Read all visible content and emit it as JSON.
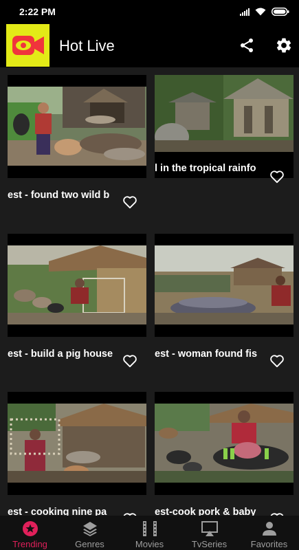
{
  "status": {
    "time": "2:22 PM"
  },
  "app": {
    "title": "Hot Live",
    "icons": {
      "logo": "video-camera-icon",
      "share": "share-icon",
      "settings": "gear-icon"
    }
  },
  "videos": [
    {
      "title": "est - found two wild b",
      "favorite_icon": "heart-outline-icon"
    },
    {
      "title": "l in the tropical rainfo",
      "favorite_icon": "heart-outline-icon"
    },
    {
      "title": "est - build a pig house",
      "favorite_icon": "heart-outline-icon"
    },
    {
      "title": "est - woman found fis",
      "favorite_icon": "heart-outline-icon"
    },
    {
      "title": "est - cooking nine pa",
      "favorite_icon": "heart-outline-icon"
    },
    {
      "title": "est-cook pork & baby",
      "favorite_icon": "heart-outline-icon"
    }
  ],
  "nav": {
    "items": [
      {
        "label": "Trending",
        "icon": "star-badge-icon",
        "active": true
      },
      {
        "label": "Genres",
        "icon": "layers-icon",
        "active": false
      },
      {
        "label": "Movies",
        "icon": "film-icon",
        "active": false
      },
      {
        "label": "TvSeries",
        "icon": "tv-icon",
        "active": false
      },
      {
        "label": "Favorites",
        "icon": "person-icon",
        "active": false
      }
    ]
  },
  "colors": {
    "accent": "#e0205a",
    "logo_bg": "#e3ea17",
    "logo_icon": "#f0343c",
    "background": "#1c1c1c",
    "bar": "#000000"
  }
}
